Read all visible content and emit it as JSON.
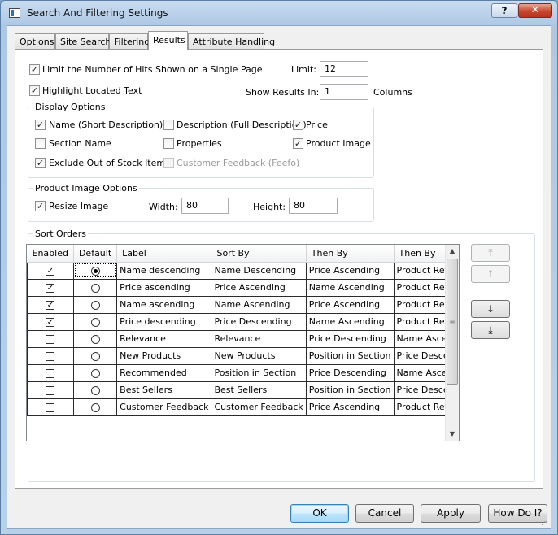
{
  "window": {
    "title": "Search And Filtering Settings",
    "help_label": "?",
    "close_label": "✕"
  },
  "tabs": [
    {
      "label": "Options"
    },
    {
      "label": "Site Search"
    },
    {
      "label": "Filtering"
    },
    {
      "label": "Results"
    },
    {
      "label": "Attribute Handling"
    }
  ],
  "results": {
    "limit_hits": {
      "label": "Limit the Number of Hits Shown on a Single Page",
      "checked": true
    },
    "highlight": {
      "label": "Highlight Located Text",
      "checked": true
    },
    "limit_label": "Limit:",
    "limit_value": "12",
    "show_in_label": "Show Results In:",
    "show_in_value": "1",
    "columns_label": "Columns"
  },
  "display_options": {
    "title": "Display Options",
    "name_short": {
      "label": "Name (Short Description)",
      "checked": true
    },
    "description_full": {
      "label": "Description (Full Description)",
      "checked": false
    },
    "price": {
      "label": "Price",
      "checked": true
    },
    "section_name": {
      "label": "Section Name",
      "checked": false
    },
    "properties": {
      "label": "Properties",
      "checked": false
    },
    "product_image": {
      "label": "Product Image",
      "checked": true
    },
    "exclude_out_of_stock": {
      "label": "Exclude Out of Stock Items",
      "checked": true
    },
    "customer_feedback": {
      "label": "Customer Feedback (Feefo)",
      "checked": false,
      "disabled": true
    }
  },
  "product_image_options": {
    "title": "Product Image Options",
    "resize": {
      "label": "Resize Image",
      "checked": true
    },
    "width_label": "Width:",
    "width_value": "80",
    "height_label": "Height:",
    "height_value": "80"
  },
  "sort_orders": {
    "title": "Sort Orders",
    "columns": [
      "Enabled",
      "Default",
      "Label",
      "Sort By",
      "Then By",
      "Then By"
    ],
    "rows": [
      {
        "enabled": true,
        "default": true,
        "label": "Name descending",
        "sort_by": "Name Descending",
        "then_by_1": "Price Ascending",
        "then_by_2": "Product Reference"
      },
      {
        "enabled": true,
        "default": false,
        "label": "Price ascending",
        "sort_by": "Price Ascending",
        "then_by_1": "Name Ascending",
        "then_by_2": "Product Reference"
      },
      {
        "enabled": true,
        "default": false,
        "label": "Name ascending",
        "sort_by": "Name Ascending",
        "then_by_1": "Price Ascending",
        "then_by_2": "Product Reference"
      },
      {
        "enabled": true,
        "default": false,
        "label": "Price descending",
        "sort_by": "Price Descending",
        "then_by_1": "Name Ascending",
        "then_by_2": "Product Reference"
      },
      {
        "enabled": false,
        "default": false,
        "label": "Relevance",
        "sort_by": "Relevance",
        "then_by_1": "Price Descending",
        "then_by_2": "Name Ascending"
      },
      {
        "enabled": false,
        "default": false,
        "label": "New Products",
        "sort_by": "New Products",
        "then_by_1": "Position in Section",
        "then_by_2": "Price Descending"
      },
      {
        "enabled": false,
        "default": false,
        "label": "Recommended",
        "sort_by": "Position in Section",
        "then_by_1": "Price Descending",
        "then_by_2": "Name Ascending"
      },
      {
        "enabled": false,
        "default": false,
        "label": "Best Sellers",
        "sort_by": "Best Sellers",
        "then_by_1": "Position in Section",
        "then_by_2": "Price Descending"
      },
      {
        "enabled": false,
        "default": false,
        "label": "Customer Feedback",
        "sort_by": "Customer Feedback",
        "then_by_1": "Price Ascending",
        "then_by_2": "Product Reference"
      }
    ],
    "buttons": {
      "move_top": {
        "label": "⤒",
        "disabled": true
      },
      "move_up": {
        "label": "↑",
        "disabled": true
      },
      "move_down": {
        "label": "↓",
        "disabled": false
      },
      "move_bottom": {
        "label": "⤓",
        "disabled": false
      }
    }
  },
  "footer": {
    "ok": "OK",
    "cancel": "Cancel",
    "apply": "Apply",
    "how_do_i": "How Do I?"
  }
}
